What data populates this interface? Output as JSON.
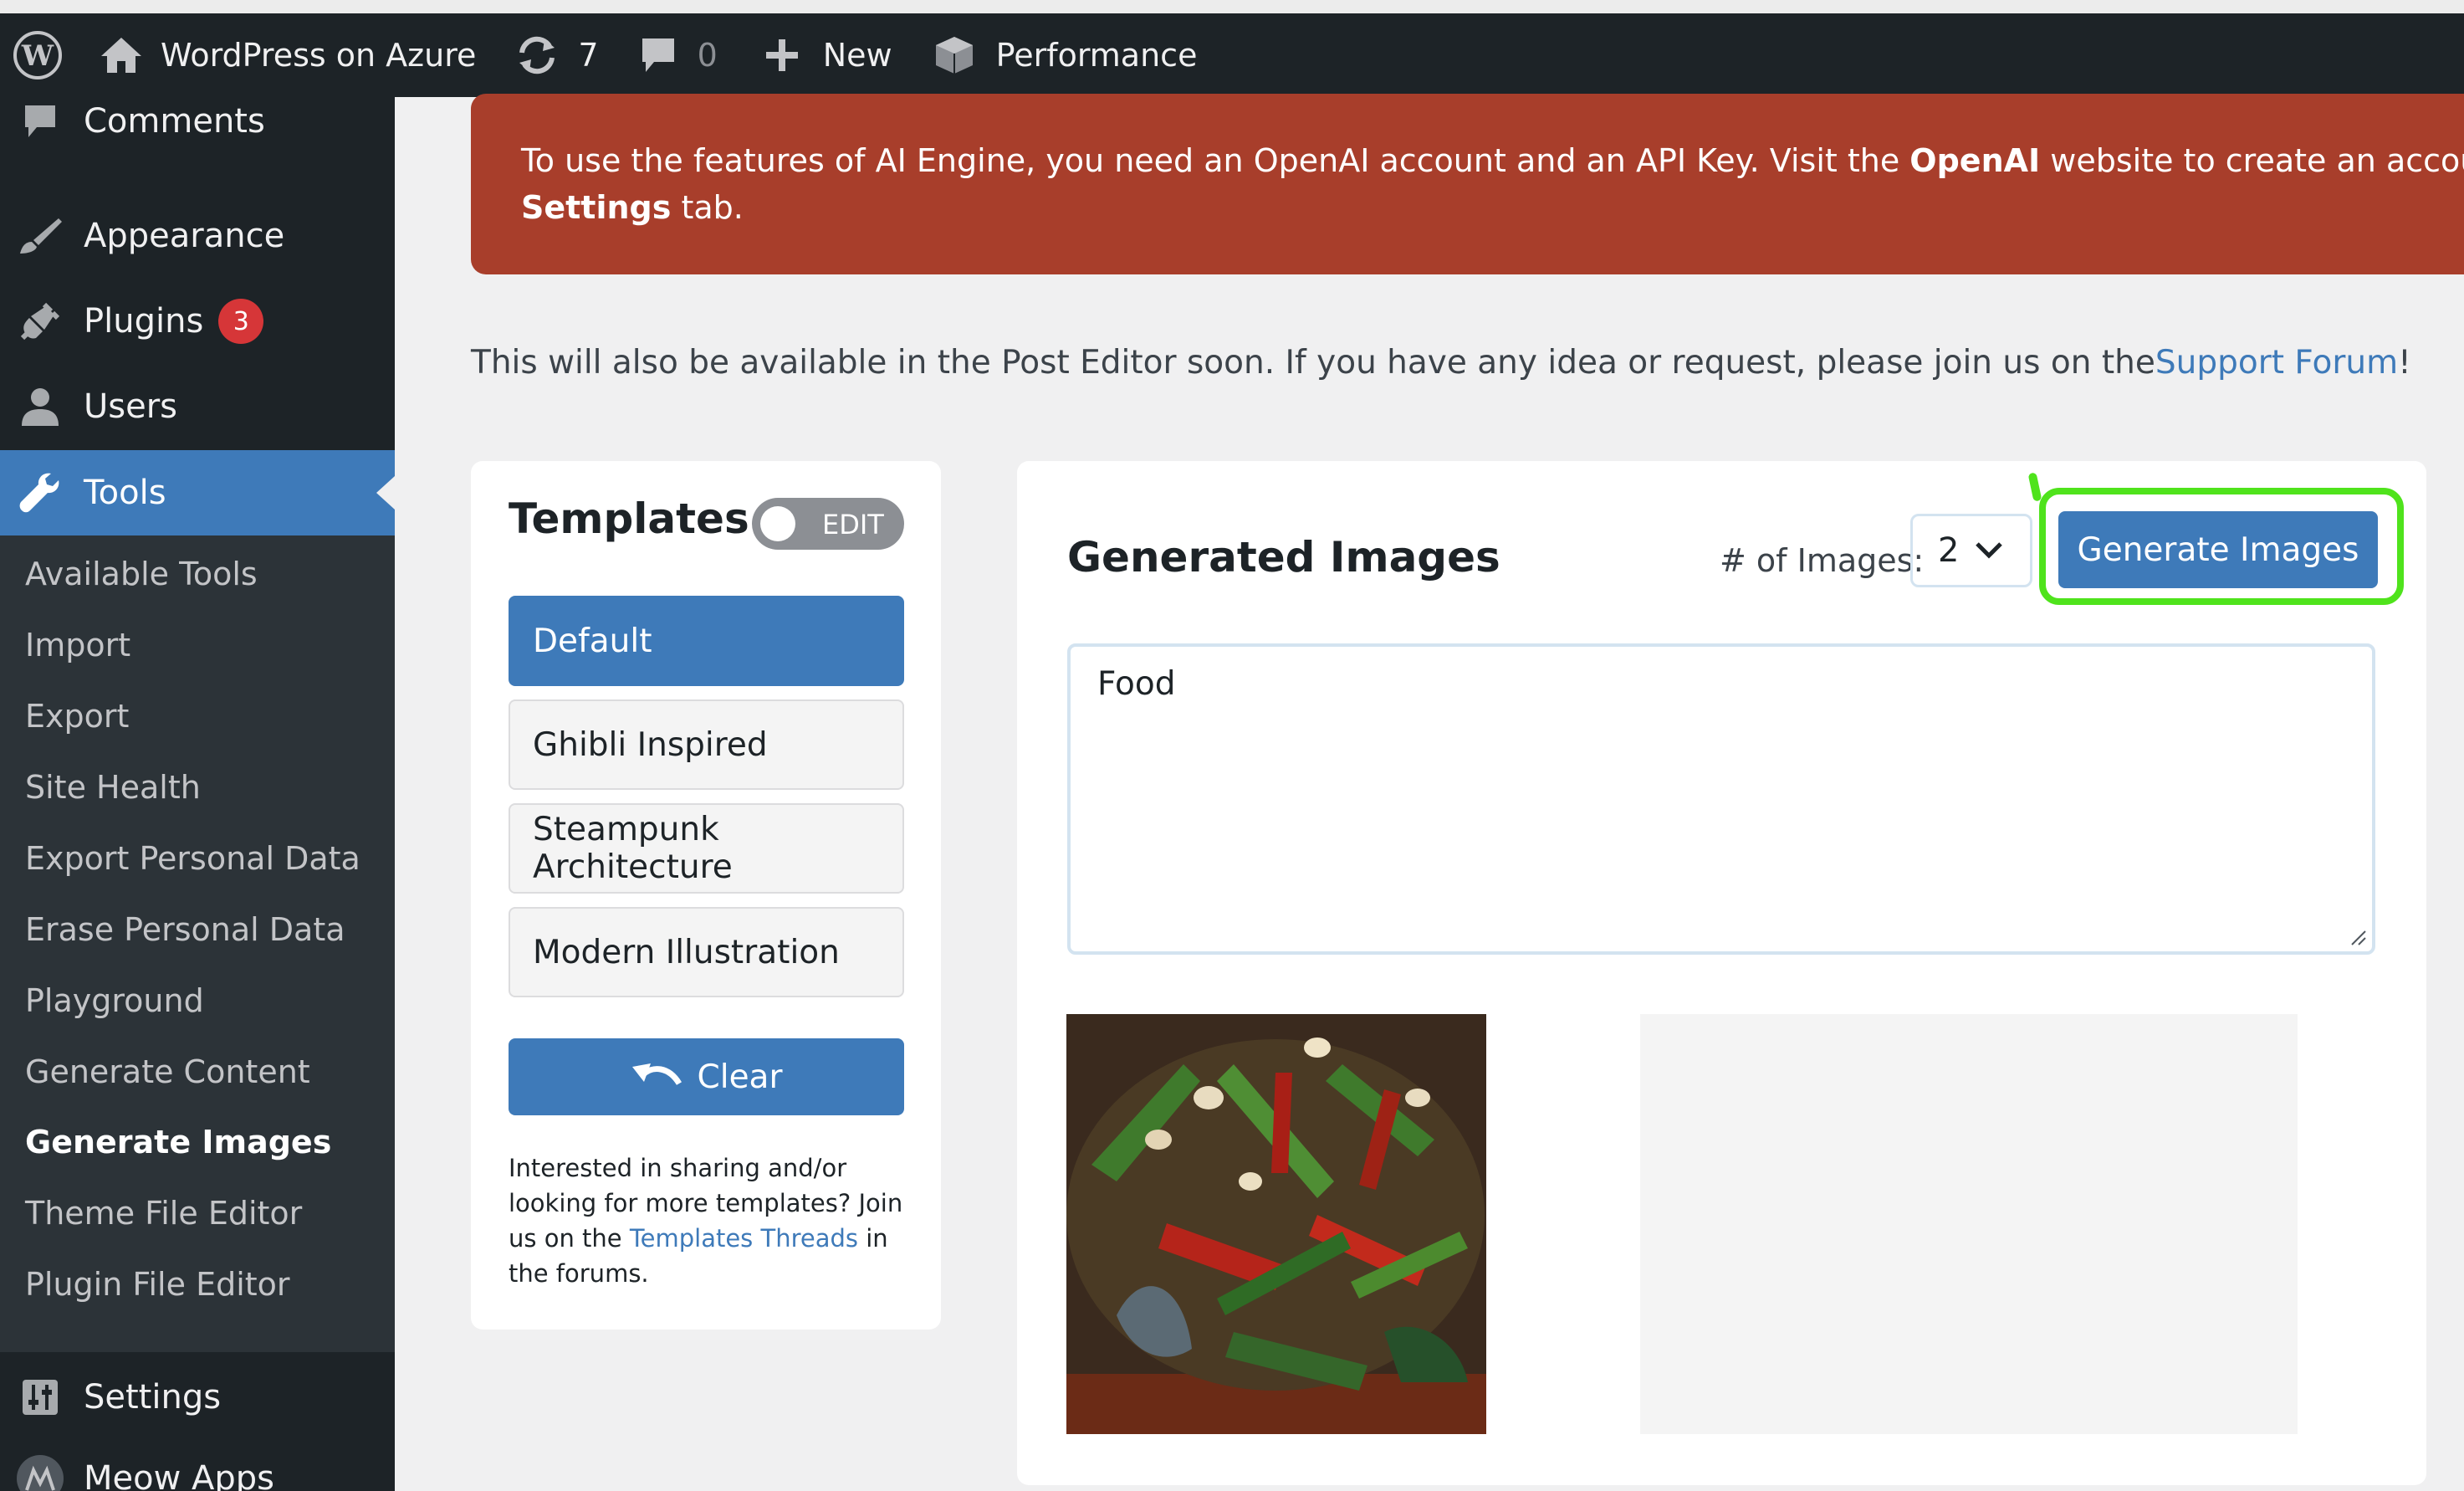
{
  "adminbar": {
    "site_name": "WordPress on Azure",
    "updates_count": "7",
    "comments_count": "0",
    "new_label": "New",
    "performance_label": "Performance"
  },
  "sidebar": {
    "comments_label": "Comments",
    "appearance_label": "Appearance",
    "plugins_label": "Plugins",
    "plugins_badge": "3",
    "users_label": "Users",
    "tools_label": "Tools",
    "settings_label": "Settings",
    "meow_label": "Meow Apps",
    "tools_submenu": [
      "Available Tools",
      "Import",
      "Export",
      "Site Health",
      "Export Personal Data",
      "Erase Personal Data",
      "Playground",
      "Generate Content",
      "Generate Images",
      "Theme File Editor",
      "Plugin File Editor"
    ]
  },
  "notice": {
    "text_before": "To use the features of AI Engine, you need an OpenAI account and an API Key. Visit the ",
    "openai": "OpenAI",
    "text_after": " website to create an account, then insert your API Key in the",
    "settings": "Settings",
    "tab_text": " tab."
  },
  "intro": {
    "text": "This will also be available in the Post Editor soon. If you have any idea or request, please join us on the ",
    "link": "Support Forum",
    "suffix": "!"
  },
  "templates": {
    "title": "Templates",
    "edit_label": "EDIT",
    "items": [
      "Default",
      "Ghibli Inspired",
      "Steampunk Architecture",
      "Modern Illustration"
    ],
    "selected": "Default",
    "clear_label": "Clear",
    "note_before": "Interested in sharing and/or looking for more templates? Join us on the ",
    "note_link": "Templates Threads",
    "note_after": " in the forums."
  },
  "generator": {
    "title": "Generated Images",
    "num_label": "# of Images:",
    "num_value": "2",
    "generate_label": "Generate Images",
    "prompt": "Food"
  },
  "colors": {
    "adminbar_bg": "#1d2327",
    "accent": "#3e7ab9",
    "notice_bg": "#a83e2b",
    "highlight": "#4fe31c",
    "badge": "#d63638"
  }
}
